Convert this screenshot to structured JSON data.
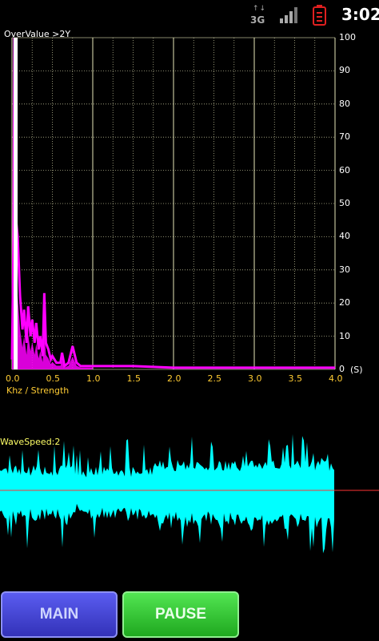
{
  "status_bar": {
    "network_type": "3G",
    "time": "3:02",
    "icons": [
      "data-arrows-icon",
      "signal-bars-icon",
      "battery-low-icon"
    ],
    "battery_color": "#e02020"
  },
  "spectrum": {
    "overvalue_label": "OverValue >2Y",
    "axis_title": "Khz / Strength",
    "unit_label": "(S)",
    "x_ticks": [
      "0.0",
      "0.5",
      "1.0",
      "1.5",
      "2.0",
      "2.5",
      "3.0",
      "3.5",
      "4.0"
    ],
    "y_ticks": [
      "100",
      "90",
      "80",
      "70",
      "60",
      "50",
      "40",
      "30",
      "20",
      "10",
      "0"
    ],
    "grid_color": "#ffffcc",
    "trace_color": "#ff00ff",
    "peak_color": "#ffffff"
  },
  "waveform": {
    "label": "WaveSpeed:2",
    "trace_color": "#00ffff",
    "baseline_color": "#ff3333"
  },
  "buttons": {
    "main_label": "MAIN",
    "pause_label": "PAUSE"
  },
  "chart_data": [
    {
      "type": "line",
      "title": "OverValue >2Y",
      "xlabel": "Khz / Strength",
      "ylabel": "",
      "xlim": [
        0,
        4.0
      ],
      "ylim": [
        0,
        100
      ],
      "grid": true,
      "series": [
        {
          "x": [
            0.0,
            0.02,
            0.03,
            0.05,
            0.07,
            0.1,
            0.13,
            0.15,
            0.18,
            0.2,
            0.23,
            0.25,
            0.28,
            0.3,
            0.33,
            0.35,
            0.38,
            0.4,
            0.42,
            0.45,
            0.48,
            0.5,
            0.55,
            0.6,
            0.62,
            0.65,
            0.7,
            0.75,
            0.8,
            0.85,
            0.9,
            1.0,
            1.5,
            2.0,
            2.5,
            3.0,
            3.5,
            4.0
          ],
          "y": [
            3,
            40,
            100,
            45,
            40,
            22,
            12,
            18,
            8,
            19,
            10,
            15,
            8,
            14,
            6,
            10,
            4,
            23,
            8,
            6,
            3,
            4,
            2,
            2,
            5,
            1,
            2,
            7,
            2,
            1,
            1,
            1,
            1,
            0.5,
            0.5,
            0.5,
            0.5,
            0.5
          ]
        }
      ]
    }
  ]
}
